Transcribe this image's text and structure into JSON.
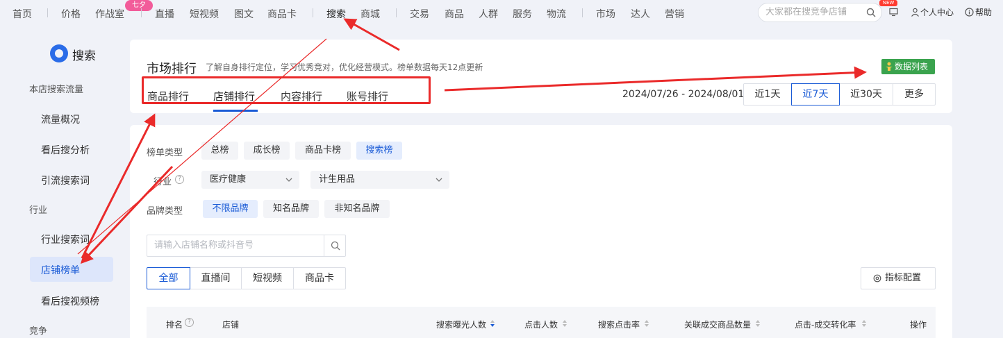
{
  "topnav": {
    "items": [
      "首页",
      "价格",
      "作战室",
      "直播",
      "短视频",
      "图文",
      "商品卡",
      "搜索",
      "商城",
      "交易",
      "商品",
      "人群",
      "服务",
      "物流",
      "市场",
      "达人",
      "营销"
    ],
    "promo_badge": "七夕",
    "search_placeholder": "大家都在搜竞争店铺",
    "new_badge": "NEW",
    "personal_center": "个人中心",
    "help": "帮助"
  },
  "sidebar": {
    "logo_text": "搜索",
    "groups": {
      "store_flow": "本店搜索流量",
      "industry": "行业",
      "competition": "竞争"
    },
    "items": [
      "流量概况",
      "看后搜分析",
      "引流搜索词",
      "行业搜索词",
      "店铺榜单",
      "看后搜视频榜"
    ],
    "active_item": "店铺榜单"
  },
  "header": {
    "title": "市场排行",
    "subtitle": "了解自身排行定位，学习优秀竞对，优化经营模式。榜单数据每天12点更新",
    "data_list_button": "数据列表",
    "tabs": [
      "商品排行",
      "店铺排行",
      "内容排行",
      "账号排行"
    ],
    "active_tab": "店铺排行",
    "date_range": "2024/07/26 - 2024/08/01",
    "periods": [
      "近1天",
      "近7天",
      "近30天",
      "更多"
    ],
    "active_period": "近7天"
  },
  "filters": {
    "list_type_label": "榜单类型",
    "list_types": [
      "总榜",
      "成长榜",
      "商品卡榜",
      "搜索榜"
    ],
    "active_list_type": "搜索榜",
    "industry_label": "行业",
    "industry_primary": "医疗健康",
    "industry_secondary": "计生用品",
    "brand_type_label": "品牌类型",
    "brand_types": [
      "不限品牌",
      "知名品牌",
      "非知名品牌"
    ],
    "active_brand_type": "不限品牌",
    "search_placeholder": "请输入店铺名称或抖音号",
    "categories": [
      "全部",
      "直播间",
      "短视频",
      "商品卡"
    ],
    "active_category": "全部",
    "metric_config": "指标配置"
  },
  "table": {
    "columns": [
      "排名",
      "店铺",
      "搜索曝光人数",
      "点击人数",
      "搜索点击率",
      "关联成交商品数量",
      "点击-成交转化率",
      "操作"
    ]
  },
  "colors": {
    "accent": "#1a5bd6",
    "annotation_red": "#ea2a2a",
    "data_list_green": "#3aa34e"
  }
}
